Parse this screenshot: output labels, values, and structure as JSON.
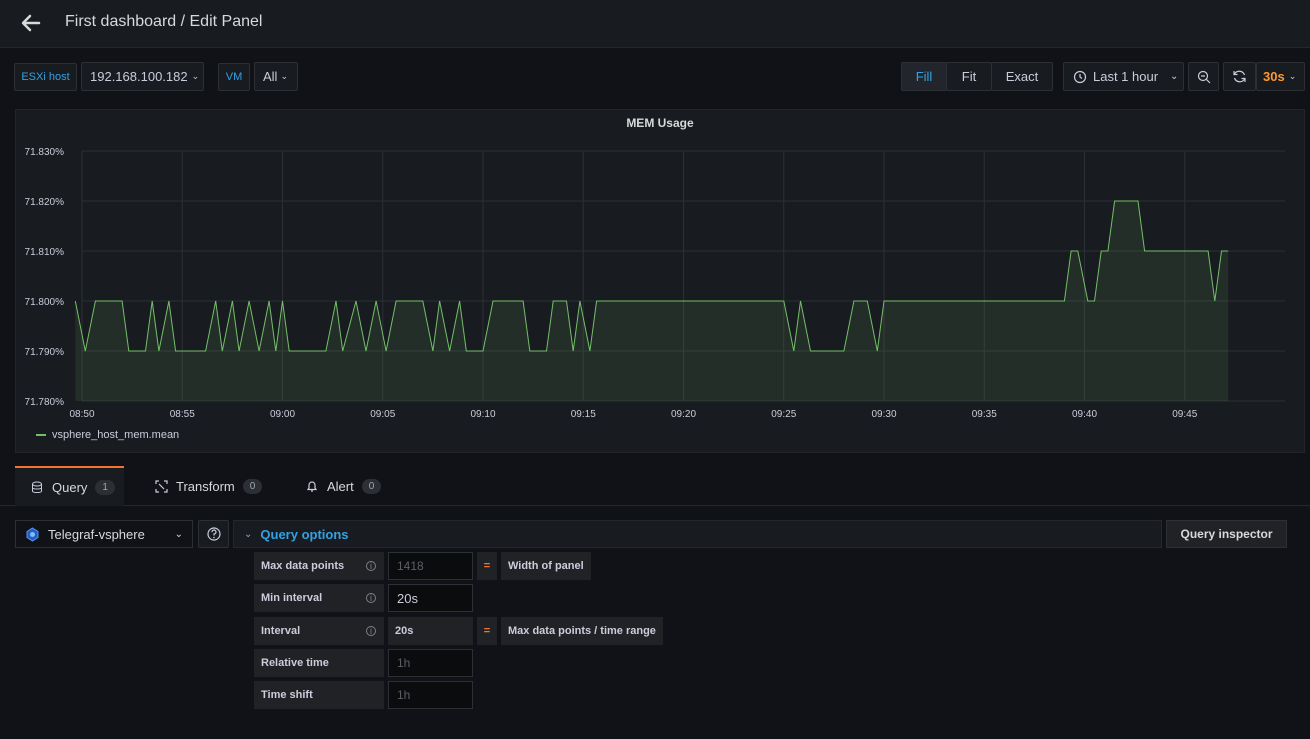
{
  "header": {
    "title": "First dashboard / Edit Panel"
  },
  "variables": [
    {
      "label": "ESXi host",
      "value": "192.168.100.182"
    },
    {
      "label": "VM",
      "value": "All"
    }
  ],
  "toolbar": {
    "fill_label": "Fill",
    "fit_label": "Fit",
    "exact_label": "Exact",
    "time_range": "Last 1 hour",
    "refresh_interval": "30s",
    "active_mode": "Fill",
    "accent_color": "#ff9830"
  },
  "panel": {
    "title": "MEM Usage",
    "legend": "vsphere_host_mem.mean"
  },
  "chart_data": {
    "type": "area",
    "title": "MEM Usage",
    "x_ticks": [
      "08:50",
      "08:55",
      "09:00",
      "09:05",
      "09:10",
      "09:15",
      "09:20",
      "09:25",
      "09:30",
      "09:35",
      "09:40",
      "09:45"
    ],
    "y_ticks": [
      "71.780%",
      "71.790%",
      "71.800%",
      "71.810%",
      "71.820%",
      "71.830%"
    ],
    "ylim": [
      71.78,
      71.83
    ],
    "xlim_minutes": [
      "08:50",
      "09:50"
    ],
    "series": [
      {
        "name": "vsphere_host_mem.mean",
        "color": "#73bf69",
        "points": [
          [
            "08:49:40",
            71.8
          ],
          [
            "08:50:10",
            71.79
          ],
          [
            "08:50:40",
            71.8
          ],
          [
            "08:52:00",
            71.8
          ],
          [
            "08:52:20",
            71.79
          ],
          [
            "08:53:10",
            71.79
          ],
          [
            "08:53:30",
            71.8
          ],
          [
            "08:53:50",
            71.79
          ],
          [
            "08:54:20",
            71.8
          ],
          [
            "08:54:40",
            71.79
          ],
          [
            "08:56:10",
            71.79
          ],
          [
            "08:56:40",
            71.8
          ],
          [
            "08:57:00",
            71.79
          ],
          [
            "08:57:30",
            71.8
          ],
          [
            "08:57:50",
            71.79
          ],
          [
            "08:58:20",
            71.8
          ],
          [
            "08:58:50",
            71.79
          ],
          [
            "08:59:20",
            71.8
          ],
          [
            "08:59:40",
            71.79
          ],
          [
            "09:00:00",
            71.8
          ],
          [
            "09:00:20",
            71.79
          ],
          [
            "09:01:00",
            71.79
          ],
          [
            "09:02:10",
            71.79
          ],
          [
            "09:02:40",
            71.8
          ],
          [
            "09:03:00",
            71.79
          ],
          [
            "09:03:40",
            71.8
          ],
          [
            "09:04:10",
            71.79
          ],
          [
            "09:04:40",
            71.8
          ],
          [
            "09:05:10",
            71.79
          ],
          [
            "09:05:40",
            71.8
          ],
          [
            "09:07:00",
            71.8
          ],
          [
            "09:07:30",
            71.79
          ],
          [
            "09:07:50",
            71.8
          ],
          [
            "09:08:20",
            71.79
          ],
          [
            "09:08:50",
            71.8
          ],
          [
            "09:09:10",
            71.79
          ],
          [
            "09:10:00",
            71.79
          ],
          [
            "09:10:30",
            71.8
          ],
          [
            "09:12:00",
            71.8
          ],
          [
            "09:12:20",
            71.79
          ],
          [
            "09:13:10",
            71.79
          ],
          [
            "09:13:30",
            71.8
          ],
          [
            "09:14:10",
            71.8
          ],
          [
            "09:14:30",
            71.79
          ],
          [
            "09:14:50",
            71.8
          ],
          [
            "09:15:20",
            71.79
          ],
          [
            "09:15:40",
            71.8
          ],
          [
            "09:20:10",
            71.8
          ],
          [
            "09:25:00",
            71.8
          ],
          [
            "09:25:30",
            71.79
          ],
          [
            "09:25:50",
            71.8
          ],
          [
            "09:26:20",
            71.79
          ],
          [
            "09:28:00",
            71.79
          ],
          [
            "09:28:30",
            71.8
          ],
          [
            "09:29:10",
            71.8
          ],
          [
            "09:29:40",
            71.79
          ],
          [
            "09:30:00",
            71.8
          ],
          [
            "09:34:00",
            71.8
          ],
          [
            "09:39:00",
            71.8
          ],
          [
            "09:39:20",
            71.81
          ],
          [
            "09:39:40",
            71.81
          ],
          [
            "09:40:10",
            71.8
          ],
          [
            "09:40:30",
            71.8
          ],
          [
            "09:40:50",
            71.81
          ],
          [
            "09:41:10",
            71.81
          ],
          [
            "09:41:30",
            71.82
          ],
          [
            "09:42:40",
            71.82
          ],
          [
            "09:43:00",
            71.81
          ],
          [
            "09:45:10",
            71.81
          ],
          [
            "09:45:20",
            71.81
          ],
          [
            "09:46:10",
            71.81
          ],
          [
            "09:46:30",
            71.8
          ],
          [
            "09:46:50",
            71.81
          ],
          [
            "09:47:10",
            71.81
          ]
        ]
      }
    ],
    "grid": true,
    "legend_position": "bottom-left"
  },
  "query_tabs": [
    {
      "label": "Query",
      "count": "1"
    },
    {
      "label": "Transform",
      "count": "0"
    },
    {
      "label": "Alert",
      "count": "0"
    }
  ],
  "query": {
    "datasource": "Telegraf-vsphere",
    "options_label": "Query options",
    "inspector_label": "Query inspector",
    "max_data_points_label": "Max data points",
    "max_data_points_placeholder": "1418",
    "width_of_panel": "Width of panel",
    "min_interval_label": "Min interval",
    "min_interval_value": "20s",
    "interval_label": "Interval",
    "interval_value": "20s",
    "interval_note": "Max data points / time range",
    "relative_time_label": "Relative time",
    "relative_time_placeholder": "1h",
    "time_shift_label": "Time shift",
    "time_shift_placeholder": "1h",
    "equals": "="
  }
}
